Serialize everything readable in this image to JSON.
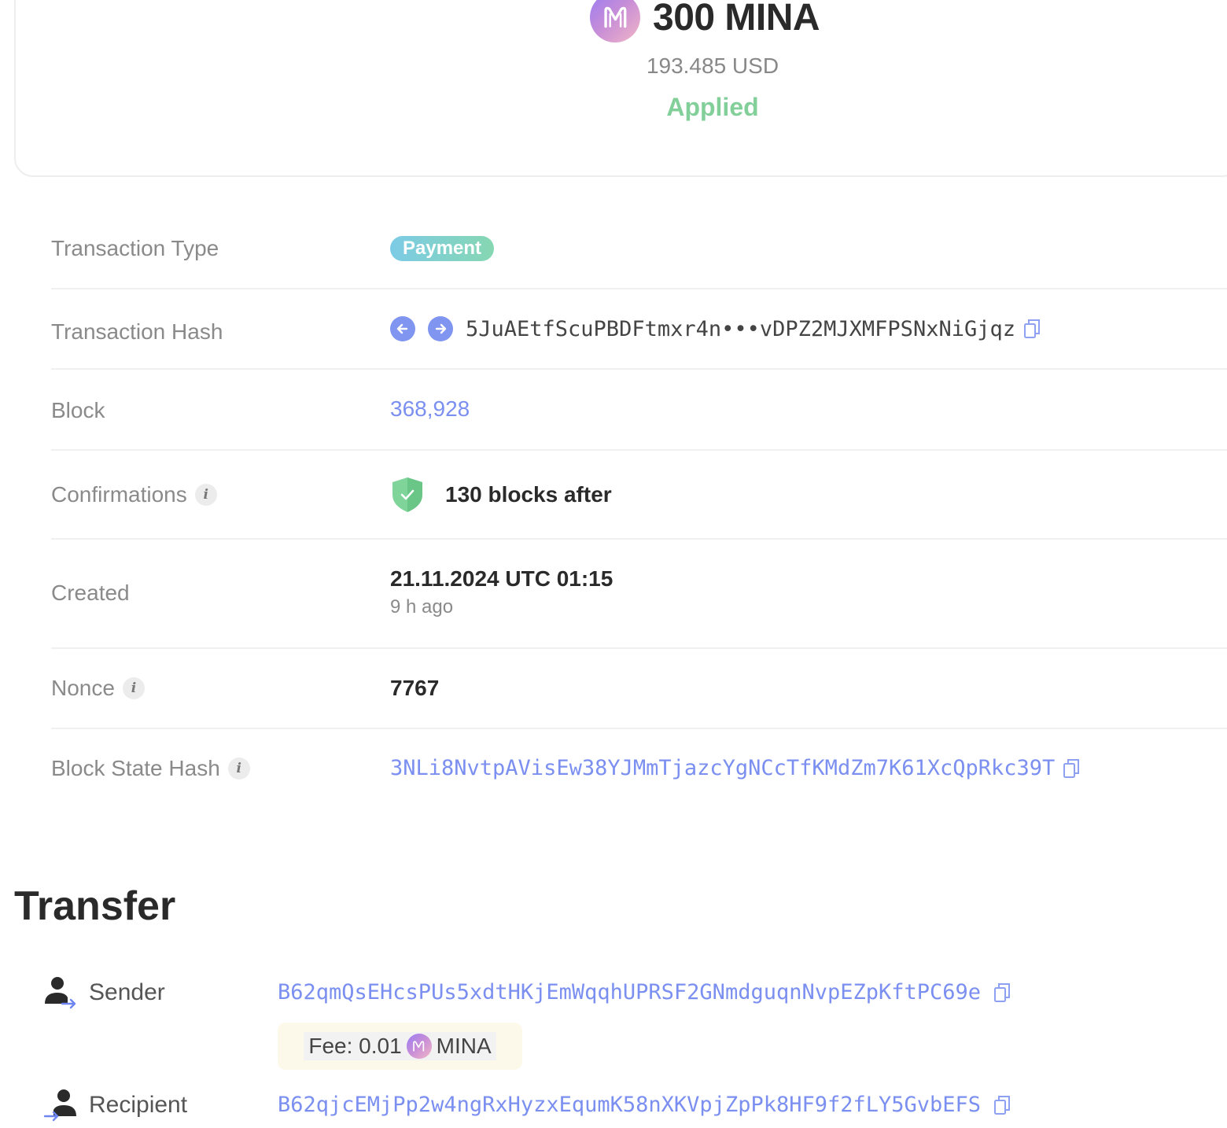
{
  "summary": {
    "amount": "300 MINA",
    "fiat": "193.485 USD",
    "status": "Applied",
    "status_color": "#82cf9a",
    "logo_icon": "mina-logo-icon"
  },
  "details": {
    "transaction_type": {
      "label": "Transaction Type",
      "value": "Payment"
    },
    "transaction_hash": {
      "label": "Transaction Hash",
      "value": "5JuAEtfScuPBDFtmxr4n•••vDPZ2MJXMFPSNxNiGjqz",
      "prev_icon": "arrow-left-icon",
      "next_icon": "arrow-right-icon"
    },
    "block": {
      "label": "Block",
      "value": "368,928"
    },
    "confirmations": {
      "label": "Confirmations",
      "value": "130 blocks after",
      "icon": "shield-check-icon"
    },
    "created": {
      "label": "Created",
      "value": "21.11.2024 UTC 01:15",
      "relative": "9 h ago"
    },
    "nonce": {
      "label": "Nonce",
      "value": "7767"
    },
    "block_state_hash": {
      "label": "Block State Hash",
      "value": "3NLi8NvtpAVisEw38YJMmTjazcYgNCcTfKMdZm7K61XcQpRkc39T"
    }
  },
  "transfer": {
    "title": "Transfer",
    "sender": {
      "label": "Sender",
      "address": "B62qmQsEHcsPUs5xdtHKjEmWqqhUPRSF2GNmdguqnNvpEZpKftPC69e"
    },
    "fee": {
      "prefix": "Fee: 0.01",
      "unit": "MINA"
    },
    "recipient": {
      "label": "Recipient",
      "address": "B62qjcEMjPp2w4ngRxHyzxEqumK58nXKVpjZpPk8HF9f2fLY5GvbEFS"
    }
  },
  "colors": {
    "link": "#7b8ff0",
    "muted": "#8a8a8a",
    "accent_purple": "#9a7cf2"
  }
}
